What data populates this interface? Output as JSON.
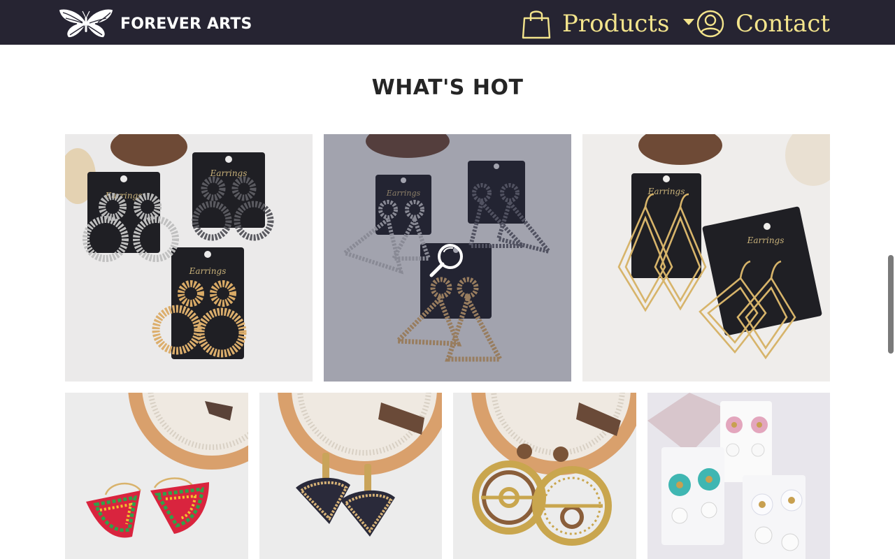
{
  "brand": {
    "name": "FOREVER ARTS",
    "logo_icon": "butterfly-icon"
  },
  "nav": {
    "products": {
      "label": "Products",
      "icon": "shopping-bag-icon",
      "dropdown_icon": "caret-down-icon"
    },
    "contact": {
      "label": "Contact",
      "icon": "user-circle-icon"
    }
  },
  "colors": {
    "navbar_bg": "#262432",
    "nav_accent": "#f3e48c",
    "title": "#252525"
  },
  "section": {
    "title": "WHAT'S HOT"
  },
  "products": [
    {
      "name": "silver-black-gold textured circle earrings",
      "card_brand": "Earrings"
    },
    {
      "name": "triangle drop earrings",
      "card_brand": "Earrings",
      "hover": true,
      "hover_icon": "magnifier-icon"
    },
    {
      "name": "gold geometric diamond earrings",
      "card_brand": "Earrings"
    },
    {
      "name": "colorful fan hoop earrings"
    },
    {
      "name": "woven fan earrings"
    },
    {
      "name": "gold wood circle earrings"
    },
    {
      "name": "flower pearl earrings"
    }
  ]
}
